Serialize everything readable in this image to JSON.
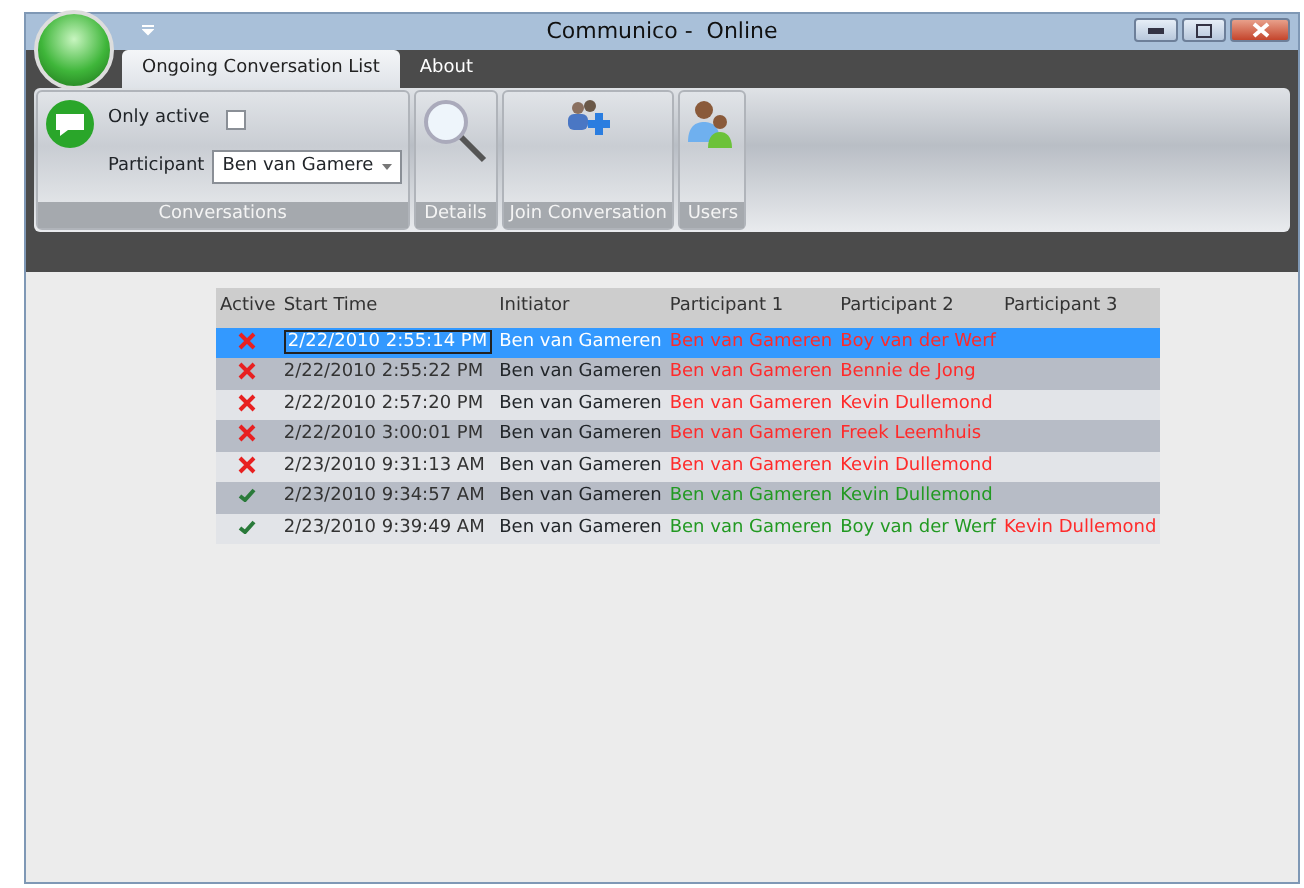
{
  "window": {
    "title": "Communico -  Online"
  },
  "tabs": [
    {
      "label": "Ongoing Conversation List",
      "selected": true
    },
    {
      "label": "About",
      "selected": false
    }
  ],
  "ribbon": {
    "groups": [
      {
        "kind": "filters",
        "label": "Conversations",
        "only_active": {
          "label": "Only active",
          "checked": false
        },
        "participant": {
          "label": "Participant",
          "value": "Ben van Gamere"
        }
      },
      {
        "kind": "details",
        "label": "Details"
      },
      {
        "kind": "join",
        "label": "Join Conversation"
      },
      {
        "kind": "users",
        "label": "Users"
      }
    ]
  },
  "table": {
    "columns": [
      "Active",
      "Start Time",
      "Initiator",
      "Participant 1",
      "Participant 2",
      "Participant 3"
    ],
    "rows": [
      {
        "active": false,
        "selected": true,
        "start_time": "2/22/2010 2:55:14 PM",
        "initiator": "Ben van Gameren",
        "participants": [
          {
            "name": "Ben van Gameren",
            "online": false
          },
          {
            "name": "Boy van der Werf",
            "online": false
          }
        ]
      },
      {
        "active": false,
        "selected": false,
        "start_time": "2/22/2010 2:55:22 PM",
        "initiator": "Ben van Gameren",
        "participants": [
          {
            "name": "Ben van Gameren",
            "online": false
          },
          {
            "name": "Bennie de Jong",
            "online": false
          }
        ]
      },
      {
        "active": false,
        "selected": false,
        "start_time": "2/22/2010 2:57:20 PM",
        "initiator": "Ben van Gameren",
        "participants": [
          {
            "name": "Ben van Gameren",
            "online": false
          },
          {
            "name": "Kevin Dullemond",
            "online": false
          }
        ]
      },
      {
        "active": false,
        "selected": false,
        "start_time": "2/22/2010 3:00:01 PM",
        "initiator": "Ben van Gameren",
        "participants": [
          {
            "name": "Ben van Gameren",
            "online": false
          },
          {
            "name": "Freek Leemhuis",
            "online": false
          }
        ]
      },
      {
        "active": false,
        "selected": false,
        "start_time": "2/23/2010 9:31:13 AM",
        "initiator": "Ben van Gameren",
        "participants": [
          {
            "name": "Ben van Gameren",
            "online": false
          },
          {
            "name": "Kevin Dullemond",
            "online": false
          }
        ]
      },
      {
        "active": true,
        "selected": false,
        "start_time": "2/23/2010 9:34:57 AM",
        "initiator": "Ben van Gameren",
        "participants": [
          {
            "name": "Ben van Gameren",
            "online": true
          },
          {
            "name": "Kevin Dullemond",
            "online": true
          }
        ]
      },
      {
        "active": true,
        "selected": false,
        "start_time": "2/23/2010 9:39:49 AM",
        "initiator": "Ben van Gameren",
        "participants": [
          {
            "name": "Ben van Gameren",
            "online": true
          },
          {
            "name": "Boy van der Werf",
            "online": true
          },
          {
            "name": "Kevin Dullemond",
            "online": false
          }
        ]
      }
    ]
  }
}
